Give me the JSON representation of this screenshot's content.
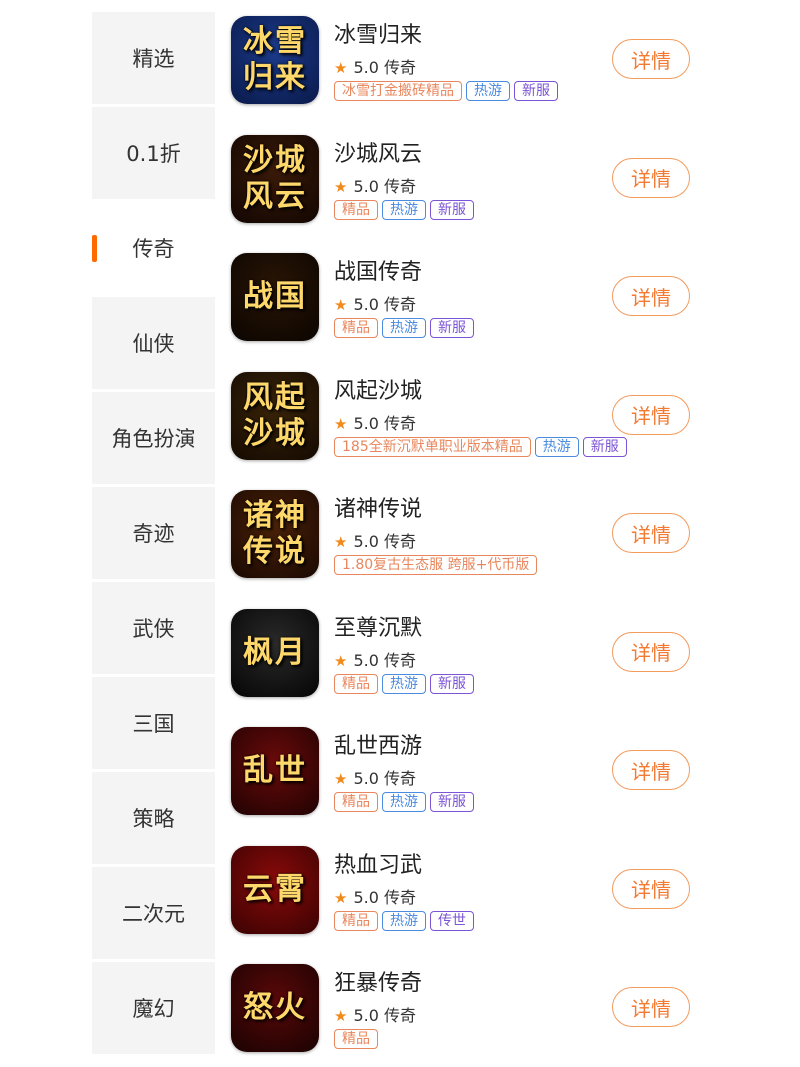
{
  "categories": [
    {
      "label": "精选",
      "active": false
    },
    {
      "label": "0.1折",
      "active": false
    },
    {
      "label": "传奇",
      "active": true
    },
    {
      "label": "仙侠",
      "active": false
    },
    {
      "label": "角色扮演",
      "active": false
    },
    {
      "label": "奇迹",
      "active": false
    },
    {
      "label": "武侠",
      "active": false
    },
    {
      "label": "三国",
      "active": false
    },
    {
      "label": "策略",
      "active": false
    },
    {
      "label": "二次元",
      "active": false
    },
    {
      "label": "魔幻",
      "active": false
    }
  ],
  "games": [
    {
      "name": "冰雪归来",
      "rating": "5.0",
      "genre": "传奇",
      "icon_text": "冰雪归来",
      "icon_colors": [
        "#1b3a8a",
        "#0a1a4a"
      ],
      "tags": [
        {
          "text": "冰雪打金搬砖精品",
          "color": "orange"
        },
        {
          "text": "热游",
          "color": "blue"
        },
        {
          "text": "新服",
          "color": "purple"
        }
      ]
    },
    {
      "name": "沙城风云",
      "rating": "5.0",
      "genre": "传奇",
      "icon_text": "沙城风云",
      "icon_colors": [
        "#3a1a08",
        "#120602"
      ],
      "tags": [
        {
          "text": "精品",
          "color": "orange"
        },
        {
          "text": "热游",
          "color": "blue"
        },
        {
          "text": "新服",
          "color": "purple"
        }
      ]
    },
    {
      "name": "战国传奇",
      "rating": "5.0",
      "genre": "传奇",
      "icon_text": "战国",
      "icon_colors": [
        "#2a1505",
        "#0b0501"
      ],
      "tags": [
        {
          "text": "精品",
          "color": "orange"
        },
        {
          "text": "热游",
          "color": "blue"
        },
        {
          "text": "新服",
          "color": "purple"
        }
      ]
    },
    {
      "name": "风起沙城",
      "rating": "5.0",
      "genre": "传奇",
      "icon_text": "风起沙城",
      "icon_colors": [
        "#3a2408",
        "#140a02"
      ],
      "tags": [
        {
          "text": "185全新沉默单职业版本精品",
          "color": "orange"
        },
        {
          "text": "热游",
          "color": "blue"
        },
        {
          "text": "新服",
          "color": "purple"
        }
      ]
    },
    {
      "name": "诸神传说",
      "rating": "5.0",
      "genre": "传奇",
      "icon_text": "诸神传说",
      "icon_colors": [
        "#4a2208",
        "#1a0802"
      ],
      "tags": [
        {
          "text": "1.80复古生态服 跨服+代币版",
          "color": "orange"
        }
      ]
    },
    {
      "name": "至尊沉默",
      "rating": "5.0",
      "genre": "传奇",
      "icon_text": "枫月",
      "icon_colors": [
        "#2a2a2a",
        "#050505"
      ],
      "tags": [
        {
          "text": "精品",
          "color": "orange"
        },
        {
          "text": "热游",
          "color": "blue"
        },
        {
          "text": "新服",
          "color": "purple"
        }
      ]
    },
    {
      "name": "乱世西游",
      "rating": "5.0",
      "genre": "传奇",
      "icon_text": "乱世",
      "icon_colors": [
        "#6a0a0a",
        "#200202"
      ],
      "tags": [
        {
          "text": "精品",
          "color": "orange"
        },
        {
          "text": "热游",
          "color": "blue"
        },
        {
          "text": "新服",
          "color": "purple"
        }
      ]
    },
    {
      "name": "热血习武",
      "rating": "5.0",
      "genre": "传奇",
      "icon_text": "云霄",
      "icon_colors": [
        "#8a0a0a",
        "#3a0202"
      ],
      "tags": [
        {
          "text": "精品",
          "color": "orange"
        },
        {
          "text": "热游",
          "color": "blue"
        },
        {
          "text": "传世",
          "color": "purple"
        }
      ]
    },
    {
      "name": "狂暴传奇",
      "rating": "5.0",
      "genre": "传奇",
      "icon_text": "怒火",
      "icon_colors": [
        "#5a0808",
        "#1a0202"
      ],
      "tags": [
        {
          "text": "精品",
          "color": "orange"
        }
      ]
    }
  ],
  "detail_label": "详情",
  "star_icon": "star-icon",
  "colors": {
    "accent": "#ff6a00",
    "detail_text": "#f27a33",
    "detail_border": "#f39a5d",
    "sidebar_bg": "#f4f4f4",
    "tag_orange": "#e8875d",
    "tag_blue": "#4b8be0",
    "tag_purple": "#7d54d6"
  }
}
